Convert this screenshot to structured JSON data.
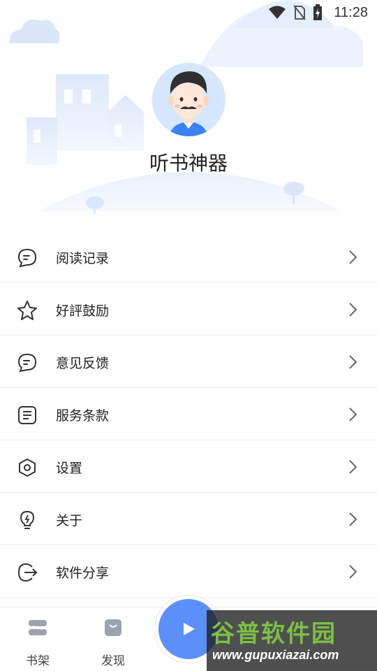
{
  "status_bar": {
    "time": "11:28"
  },
  "profile": {
    "nickname": "听书神器"
  },
  "menu": [
    {
      "label": "阅读记录",
      "icon": "chat-bubble-icon"
    },
    {
      "label": "好評鼓励",
      "icon": "star-icon"
    },
    {
      "label": "意见反馈",
      "icon": "chat-bubble-icon"
    },
    {
      "label": "服务条款",
      "icon": "document-icon"
    },
    {
      "label": "设置",
      "icon": "hexagon-settings-icon"
    },
    {
      "label": "关于",
      "icon": "lightbulb-icon"
    },
    {
      "label": "软件分享",
      "icon": "share-arrow-icon"
    }
  ],
  "bottom_nav": {
    "bookshelf": "书架",
    "discover": "发现"
  },
  "watermark": {
    "main": "谷普软件园",
    "sub": "www.gupuxiazai.com"
  },
  "colors": {
    "accent": "#5b8ff9",
    "header_light": "#e8effd"
  }
}
